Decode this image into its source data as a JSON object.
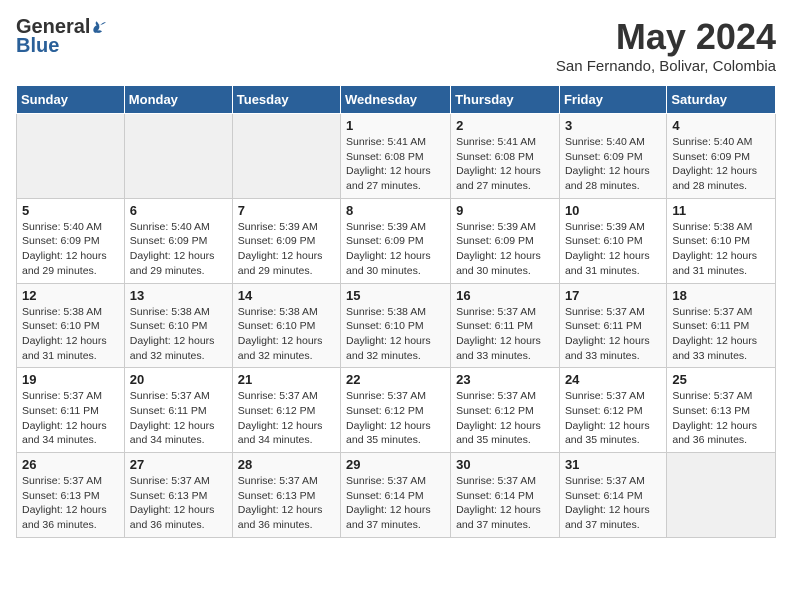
{
  "logo": {
    "general": "General",
    "blue": "Blue"
  },
  "title": "May 2024",
  "subtitle": "San Fernando, Bolivar, Colombia",
  "days_header": [
    "Sunday",
    "Monday",
    "Tuesday",
    "Wednesday",
    "Thursday",
    "Friday",
    "Saturday"
  ],
  "weeks": [
    [
      {
        "day": "",
        "info": ""
      },
      {
        "day": "",
        "info": ""
      },
      {
        "day": "",
        "info": ""
      },
      {
        "day": "1",
        "info": "Sunrise: 5:41 AM\nSunset: 6:08 PM\nDaylight: 12 hours and 27 minutes."
      },
      {
        "day": "2",
        "info": "Sunrise: 5:41 AM\nSunset: 6:08 PM\nDaylight: 12 hours and 27 minutes."
      },
      {
        "day": "3",
        "info": "Sunrise: 5:40 AM\nSunset: 6:09 PM\nDaylight: 12 hours and 28 minutes."
      },
      {
        "day": "4",
        "info": "Sunrise: 5:40 AM\nSunset: 6:09 PM\nDaylight: 12 hours and 28 minutes."
      }
    ],
    [
      {
        "day": "5",
        "info": "Sunrise: 5:40 AM\nSunset: 6:09 PM\nDaylight: 12 hours and 29 minutes."
      },
      {
        "day": "6",
        "info": "Sunrise: 5:40 AM\nSunset: 6:09 PM\nDaylight: 12 hours and 29 minutes."
      },
      {
        "day": "7",
        "info": "Sunrise: 5:39 AM\nSunset: 6:09 PM\nDaylight: 12 hours and 29 minutes."
      },
      {
        "day": "8",
        "info": "Sunrise: 5:39 AM\nSunset: 6:09 PM\nDaylight: 12 hours and 30 minutes."
      },
      {
        "day": "9",
        "info": "Sunrise: 5:39 AM\nSunset: 6:09 PM\nDaylight: 12 hours and 30 minutes."
      },
      {
        "day": "10",
        "info": "Sunrise: 5:39 AM\nSunset: 6:10 PM\nDaylight: 12 hours and 31 minutes."
      },
      {
        "day": "11",
        "info": "Sunrise: 5:38 AM\nSunset: 6:10 PM\nDaylight: 12 hours and 31 minutes."
      }
    ],
    [
      {
        "day": "12",
        "info": "Sunrise: 5:38 AM\nSunset: 6:10 PM\nDaylight: 12 hours and 31 minutes."
      },
      {
        "day": "13",
        "info": "Sunrise: 5:38 AM\nSunset: 6:10 PM\nDaylight: 12 hours and 32 minutes."
      },
      {
        "day": "14",
        "info": "Sunrise: 5:38 AM\nSunset: 6:10 PM\nDaylight: 12 hours and 32 minutes."
      },
      {
        "day": "15",
        "info": "Sunrise: 5:38 AM\nSunset: 6:10 PM\nDaylight: 12 hours and 32 minutes."
      },
      {
        "day": "16",
        "info": "Sunrise: 5:37 AM\nSunset: 6:11 PM\nDaylight: 12 hours and 33 minutes."
      },
      {
        "day": "17",
        "info": "Sunrise: 5:37 AM\nSunset: 6:11 PM\nDaylight: 12 hours and 33 minutes."
      },
      {
        "day": "18",
        "info": "Sunrise: 5:37 AM\nSunset: 6:11 PM\nDaylight: 12 hours and 33 minutes."
      }
    ],
    [
      {
        "day": "19",
        "info": "Sunrise: 5:37 AM\nSunset: 6:11 PM\nDaylight: 12 hours and 34 minutes."
      },
      {
        "day": "20",
        "info": "Sunrise: 5:37 AM\nSunset: 6:11 PM\nDaylight: 12 hours and 34 minutes."
      },
      {
        "day": "21",
        "info": "Sunrise: 5:37 AM\nSunset: 6:12 PM\nDaylight: 12 hours and 34 minutes."
      },
      {
        "day": "22",
        "info": "Sunrise: 5:37 AM\nSunset: 6:12 PM\nDaylight: 12 hours and 35 minutes."
      },
      {
        "day": "23",
        "info": "Sunrise: 5:37 AM\nSunset: 6:12 PM\nDaylight: 12 hours and 35 minutes."
      },
      {
        "day": "24",
        "info": "Sunrise: 5:37 AM\nSunset: 6:12 PM\nDaylight: 12 hours and 35 minutes."
      },
      {
        "day": "25",
        "info": "Sunrise: 5:37 AM\nSunset: 6:13 PM\nDaylight: 12 hours and 36 minutes."
      }
    ],
    [
      {
        "day": "26",
        "info": "Sunrise: 5:37 AM\nSunset: 6:13 PM\nDaylight: 12 hours and 36 minutes."
      },
      {
        "day": "27",
        "info": "Sunrise: 5:37 AM\nSunset: 6:13 PM\nDaylight: 12 hours and 36 minutes."
      },
      {
        "day": "28",
        "info": "Sunrise: 5:37 AM\nSunset: 6:13 PM\nDaylight: 12 hours and 36 minutes."
      },
      {
        "day": "29",
        "info": "Sunrise: 5:37 AM\nSunset: 6:14 PM\nDaylight: 12 hours and 37 minutes."
      },
      {
        "day": "30",
        "info": "Sunrise: 5:37 AM\nSunset: 6:14 PM\nDaylight: 12 hours and 37 minutes."
      },
      {
        "day": "31",
        "info": "Sunrise: 5:37 AM\nSunset: 6:14 PM\nDaylight: 12 hours and 37 minutes."
      },
      {
        "day": "",
        "info": ""
      }
    ]
  ]
}
